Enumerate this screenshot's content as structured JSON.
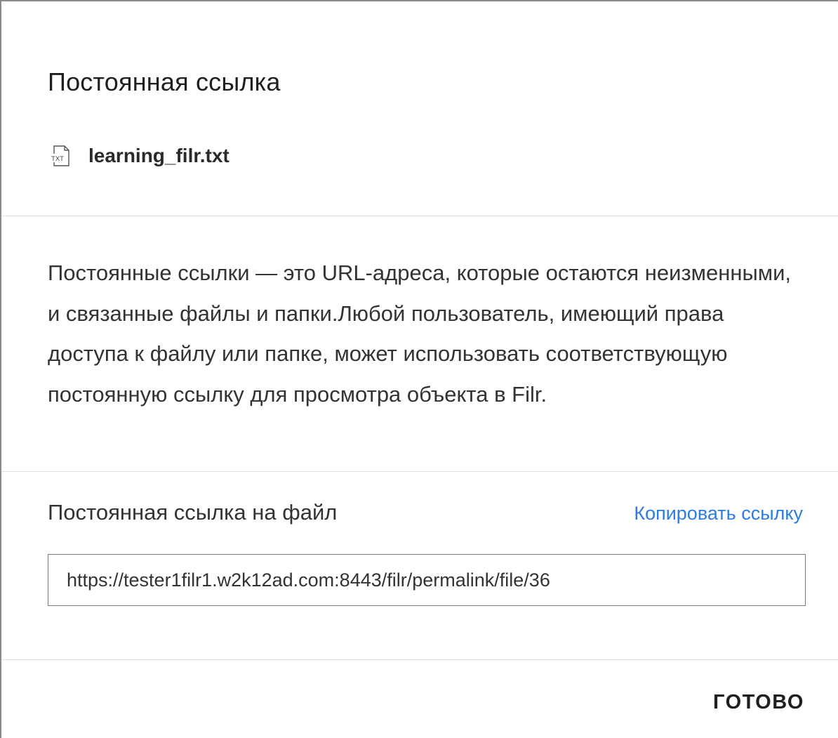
{
  "dialog": {
    "title": "Постоянная ссылка",
    "file": {
      "icon": "txt-file-icon",
      "icon_text": "TXT",
      "name": "learning_filr.txt"
    },
    "description": "Постоянные ссылки — это URL-адреса, которые остаются неизменными, и связанные файлы и папки.Любой пользователь, имеющий права доступа к файлу или папке, может использовать соответствующую постоянную ссылку для просмотра объекта в Filr.",
    "link": {
      "label": "Постоянная ссылка на файл",
      "copy_label": "Копировать ссылку",
      "url": "https://tester1filr1.w2k12ad.com:8443/filr/permalink/file/36"
    },
    "footer": {
      "done_label": "ГОТОВО"
    }
  },
  "colors": {
    "accent": "#2b7de1",
    "text": "#333333",
    "divider": "#e2e2e2"
  }
}
